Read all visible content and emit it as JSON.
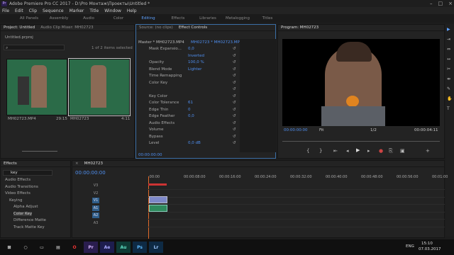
{
  "window": {
    "title": "Adobe Premiere Pro CC 2017 - D:\\Pro Монтаж\\Проекты\\Untitled *",
    "app_icon": "Pr"
  },
  "menu": [
    "File",
    "Edit",
    "Clip",
    "Sequence",
    "Marker",
    "Title",
    "Window",
    "Help"
  ],
  "workspaces": [
    "All Panels",
    "Assembly",
    "Audio",
    "Color",
    "Editing",
    "Effects",
    "Libraries",
    "Metalogging",
    "Titles"
  ],
  "project": {
    "tabs": [
      "Project: Untitled",
      "Audio Clip Mixer: MH02723"
    ],
    "file": "Untitled.prproj",
    "count": "1 of 2 items selected",
    "items": [
      {
        "name": "MH02723.MP4",
        "dur": "29:15"
      },
      {
        "name": "MH02723",
        "dur": "4:11"
      }
    ]
  },
  "effect_controls": {
    "tabs": [
      "Source: (no clips)",
      "Effect Controls"
    ],
    "master": "Master * MH02723.MP4",
    "seq": "MH02723 * MH02723.MP4",
    "rows": [
      {
        "label": "Mask Expansio...",
        "val": "0,0"
      },
      {
        "label": "",
        "val": "Inverted"
      },
      {
        "label": "Opacity",
        "val": "100,0 %"
      },
      {
        "label": "Blend Mode",
        "val": "Lighter"
      },
      {
        "label": "Time Remapping",
        "val": ""
      },
      {
        "label": "Color Key",
        "val": ""
      },
      {
        "label": "",
        "val": ""
      },
      {
        "label": "Key Color",
        "val": ""
      },
      {
        "label": "Color Tolerance",
        "val": "61"
      },
      {
        "label": "Edge Thin",
        "val": "0"
      },
      {
        "label": "Edge Feather",
        "val": "0,0"
      },
      {
        "label": "Audio Effects",
        "val": ""
      },
      {
        "label": "Volume",
        "val": ""
      },
      {
        "label": "Bypass",
        "val": ""
      },
      {
        "label": "Level",
        "val": "0,0 dB"
      }
    ],
    "timecode": "00:00:00:00"
  },
  "program": {
    "title": "Program: MH02723",
    "timecode": "00:00:00:00",
    "fit": "Fit",
    "res": "1/2",
    "duration": "00:00:04:11"
  },
  "effects": {
    "title": "Effects",
    "search": "key",
    "tree": [
      "Audio Effects",
      "Audio Transitions",
      "Video Effects",
      "Keying",
      "Alpha Adjust",
      "Color Key",
      "Difference Matte",
      "Track Matte Key"
    ]
  },
  "timeline": {
    "seq": "MH02723",
    "timecode": "00:00:00:00",
    "ruler": [
      ":00:00",
      "00:00:08:00",
      "00:00:16:00",
      "00:00:24:00",
      "00:00:32:00",
      "00:00:40:00",
      "00:00:48:00",
      "00:00:56:00",
      "00:01:00"
    ],
    "tracks": [
      "V3",
      "V2",
      "V1",
      "A1",
      "A2",
      "A3"
    ]
  },
  "taskbar": {
    "apps": [
      "Pr",
      "Ae",
      "Au",
      "Ps",
      "Lr"
    ],
    "lang": "ENG",
    "time": "15:10",
    "date": "07.03.2017"
  },
  "colors": {
    "accent": "#4f8ff0",
    "playhead": "#e06a2a",
    "clip_video": "#7d88c8",
    "clip_audio": "#2f8a5e"
  }
}
